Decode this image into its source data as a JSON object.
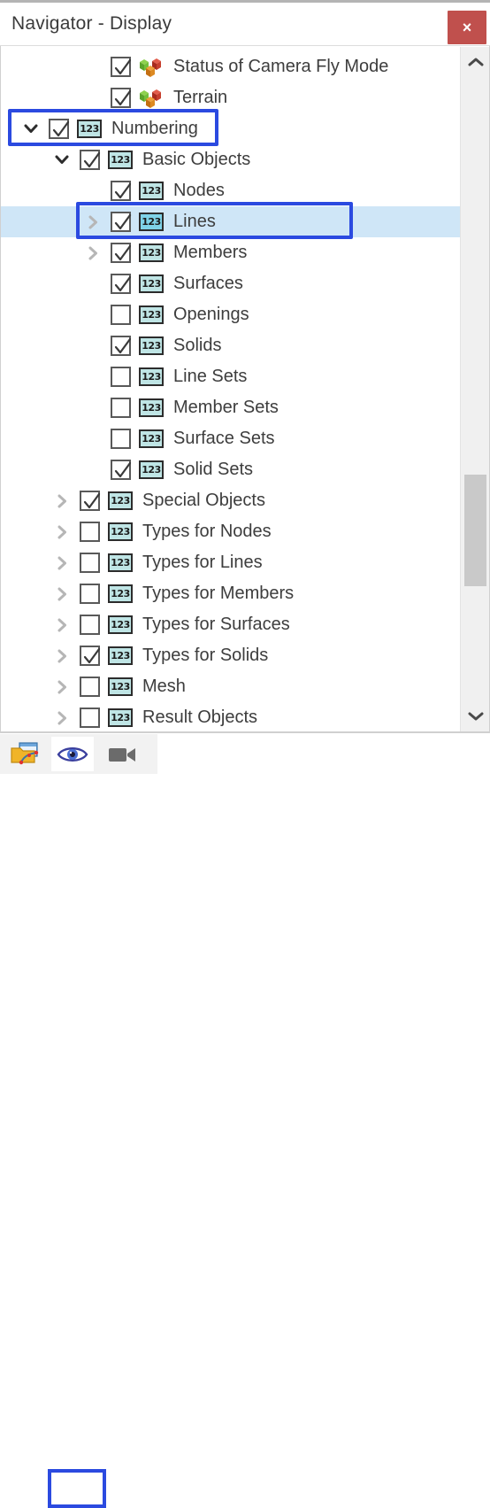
{
  "window": {
    "title": "Navigator - Display",
    "close_label": "×",
    "close_icon": "close-icon"
  },
  "colors": {
    "accent_annotation": "#2b4ae0",
    "selection_row": "#cfe6f7",
    "close_button": "#c0504d",
    "badge_fill": "#bfe5e5",
    "badge_fill_selected": "#7fd3e8",
    "badge_border": "#2c2c2c",
    "scrollbar_thumb": "#c9c9c9",
    "text": "#3d3d3d"
  },
  "tree": {
    "badge_text": "123",
    "items": [
      {
        "label": "Status of Camera Fly Mode",
        "indent": 2,
        "checked": true,
        "icon": "cubes",
        "twisty": "none",
        "selected": false,
        "annotated": false
      },
      {
        "label": "Terrain",
        "indent": 2,
        "checked": true,
        "icon": "cubes",
        "twisty": "none",
        "selected": false,
        "annotated": false
      },
      {
        "label": "Numbering",
        "indent": 0,
        "checked": true,
        "icon": "badge",
        "twisty": "expanded",
        "selected": false,
        "annotated": true
      },
      {
        "label": "Basic Objects",
        "indent": 1,
        "checked": true,
        "icon": "badge",
        "twisty": "expanded",
        "selected": false,
        "annotated": false
      },
      {
        "label": "Nodes",
        "indent": 2,
        "checked": true,
        "icon": "badge",
        "twisty": "none",
        "selected": false,
        "annotated": false
      },
      {
        "label": "Lines",
        "indent": 2,
        "checked": true,
        "icon": "badge",
        "twisty": "collapsed",
        "selected": true,
        "annotated": true
      },
      {
        "label": "Members",
        "indent": 2,
        "checked": true,
        "icon": "badge",
        "twisty": "collapsed",
        "selected": false,
        "annotated": false
      },
      {
        "label": "Surfaces",
        "indent": 2,
        "checked": true,
        "icon": "badge",
        "twisty": "none",
        "selected": false,
        "annotated": false
      },
      {
        "label": "Openings",
        "indent": 2,
        "checked": false,
        "icon": "badge",
        "twisty": "none",
        "selected": false,
        "annotated": false
      },
      {
        "label": "Solids",
        "indent": 2,
        "checked": true,
        "icon": "badge",
        "twisty": "none",
        "selected": false,
        "annotated": false
      },
      {
        "label": "Line Sets",
        "indent": 2,
        "checked": false,
        "icon": "badge",
        "twisty": "none",
        "selected": false,
        "annotated": false
      },
      {
        "label": "Member Sets",
        "indent": 2,
        "checked": false,
        "icon": "badge",
        "twisty": "none",
        "selected": false,
        "annotated": false
      },
      {
        "label": "Surface Sets",
        "indent": 2,
        "checked": false,
        "icon": "badge",
        "twisty": "none",
        "selected": false,
        "annotated": false
      },
      {
        "label": "Solid Sets",
        "indent": 2,
        "checked": true,
        "icon": "badge",
        "twisty": "none",
        "selected": false,
        "annotated": false
      },
      {
        "label": "Special Objects",
        "indent": 1,
        "checked": true,
        "icon": "badge",
        "twisty": "collapsed",
        "selected": false,
        "annotated": false
      },
      {
        "label": "Types for Nodes",
        "indent": 1,
        "checked": false,
        "icon": "badge",
        "twisty": "collapsed",
        "selected": false,
        "annotated": false
      },
      {
        "label": "Types for Lines",
        "indent": 1,
        "checked": false,
        "icon": "badge",
        "twisty": "collapsed",
        "selected": false,
        "annotated": false
      },
      {
        "label": "Types for Members",
        "indent": 1,
        "checked": false,
        "icon": "badge",
        "twisty": "collapsed",
        "selected": false,
        "annotated": false
      },
      {
        "label": "Types for Surfaces",
        "indent": 1,
        "checked": false,
        "icon": "badge",
        "twisty": "collapsed",
        "selected": false,
        "annotated": false
      },
      {
        "label": "Types for Solids",
        "indent": 1,
        "checked": true,
        "icon": "badge",
        "twisty": "collapsed",
        "selected": false,
        "annotated": false
      },
      {
        "label": "Mesh",
        "indent": 1,
        "checked": false,
        "icon": "badge",
        "twisty": "collapsed",
        "selected": false,
        "annotated": false
      },
      {
        "label": "Result Objects",
        "indent": 1,
        "checked": false,
        "icon": "badge",
        "twisty": "collapsed",
        "selected": false,
        "annotated": false
      }
    ]
  },
  "scrollbar": {
    "up_icon": "chevron-up-icon",
    "down_icon": "chevron-down-icon",
    "thumb_icon": "scrollbar-thumb"
  },
  "toolbar": {
    "buttons": [
      {
        "icon": "open-model-folder-icon",
        "selected": false
      },
      {
        "icon": "eye-icon",
        "selected": true
      },
      {
        "icon": "video-camera-icon",
        "selected": false
      }
    ]
  }
}
